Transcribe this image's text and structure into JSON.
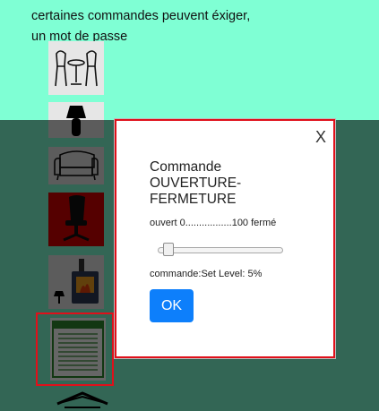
{
  "page": {
    "note_line1": "certaines commandes peuvent éxiger,",
    "note_line2": "un mot de passe"
  },
  "devices": [
    {
      "name": "table-chairs",
      "icon": "table-chairs-icon"
    },
    {
      "name": "lamp",
      "icon": "lamp-icon"
    },
    {
      "name": "sofa",
      "icon": "sofa-icon"
    },
    {
      "name": "office-chair",
      "icon": "office-chair-icon"
    },
    {
      "name": "stove",
      "icon": "stove-icon"
    },
    {
      "name": "shutter",
      "icon": "shutter-icon",
      "selected": true
    },
    {
      "name": "garage",
      "icon": "garage-icon"
    }
  ],
  "modal": {
    "close_label": "X",
    "title_line1": "Commande",
    "title_line2": "OUVERTURE-",
    "title_line3": "FERMETURE",
    "range_label": "ouvert 0.................100 fermé",
    "slider_value": 5,
    "slider_min": 0,
    "slider_max": 100,
    "status_text": "commande:Set Level: 5%",
    "ok_label": "OK"
  },
  "colors": {
    "page_bg": "#7fffd4",
    "highlight": "#e0101a",
    "ok_button": "#0d7ffb"
  }
}
